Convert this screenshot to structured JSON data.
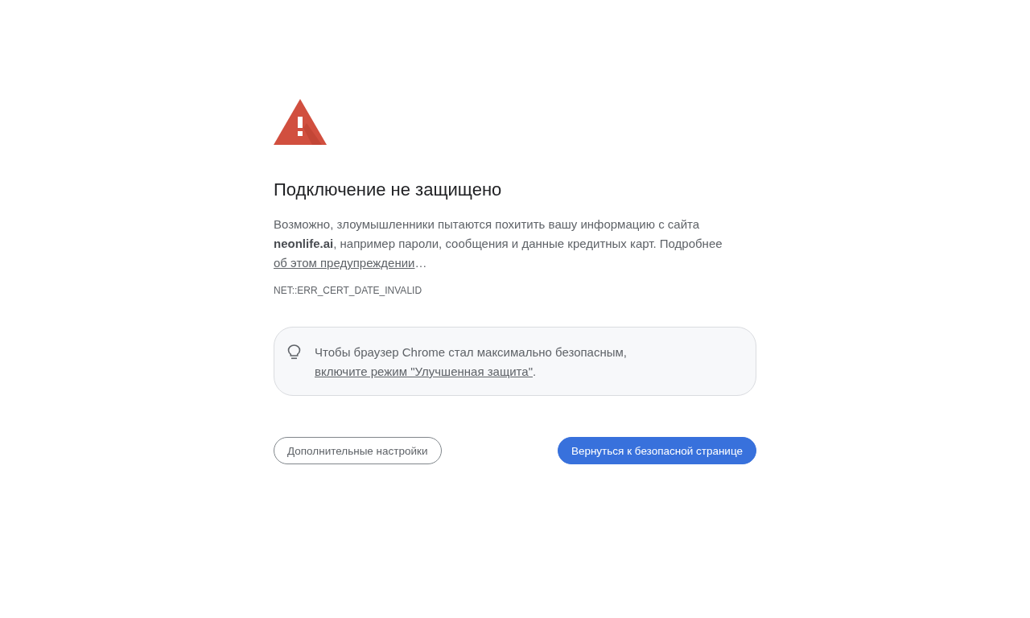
{
  "warning": {
    "title": "Подключение не защищено",
    "description": {
      "text": "Возможно, злоумышленники пытаются похитить вашу информацию с сайта **neonlife.ai**, например пароли, сообщения и данные кредитных карт. Подробнее",
      "link": "об этом предупреждении",
      "after_link": "…"
    },
    "error_code": "NET::ERR_CERT_DATE_INVALID"
  },
  "tip": {
    "text": "Чтобы браузер Chrome стал максимально безопасным,",
    "link": "включите режим \"Улучшенная защита\"",
    "after_link": "."
  },
  "buttons": [
    {
      "label": "Дополнительные настройки",
      "kind": "secondary"
    },
    {
      "label": "Вернуться к безопасной странице",
      "kind": "primary"
    }
  ]
}
